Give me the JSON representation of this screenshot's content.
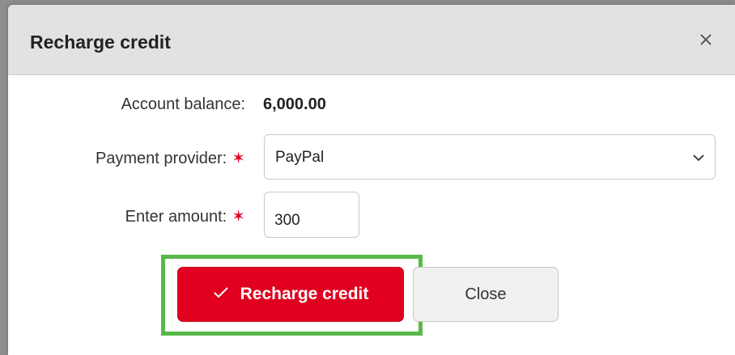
{
  "dialog": {
    "title": "Recharge credit",
    "close_icon": "close-icon"
  },
  "form": {
    "balance_label": "Account balance:",
    "balance_value": "6,000.00",
    "provider_label": "Payment provider:",
    "provider_selected": "PayPal",
    "amount_label": "Enter amount:",
    "amount_value": "300",
    "required_marker": "✶"
  },
  "actions": {
    "submit_label": "Recharge credit",
    "submit_icon": "checkmark-icon",
    "close_label": "Close"
  },
  "colors": {
    "primary": "#e1001f",
    "highlight": "#57b947",
    "header_bg": "#e2e2e2"
  }
}
